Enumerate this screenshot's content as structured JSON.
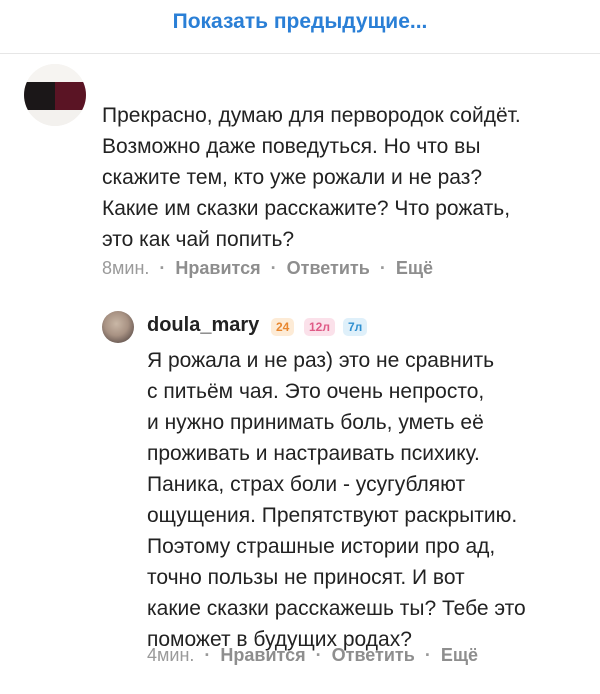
{
  "show_previous": "Показать предыдущие...",
  "comment1": {
    "text": "Прекрасно, думаю для первородок сойдёт.\nВозможно даже поведуться. Но что вы\nскажите тем, кто уже рожали и не раз?\nКакие им сказки расскажите? Что рожать,\nэто как чай попить?",
    "time": "8мин.",
    "like": "Нравится",
    "reply": "Ответить",
    "more": "Ещё"
  },
  "reply1": {
    "username": "doula_mary",
    "badges": [
      "24",
      "12л",
      "7л"
    ],
    "text": "Я рожала и не раз) это не сравнить\nс питьём чая. Это очень непросто,\nи нужно принимать боль, уметь её\nпроживать и настраивать психику.\nПаника, страх боли - усугубляют\nощущения. Препятствуют раскрытию.\nПоэтому страшные истории про ад,\nточно пользы не приносят. И вот\nкакие сказки расскажешь ты? Тебе это\nпоможет в будущих родах?",
    "time": "4мин.",
    "like": "Нравится",
    "reply": "Ответить",
    "more": "Ещё"
  },
  "separator": "·",
  "colors": {
    "link": "#2a7fd6",
    "meta": "#9a9a9a",
    "badge_orange": "#e8862e",
    "badge_pink": "#df5a86",
    "badge_blue": "#2e8fd0"
  }
}
